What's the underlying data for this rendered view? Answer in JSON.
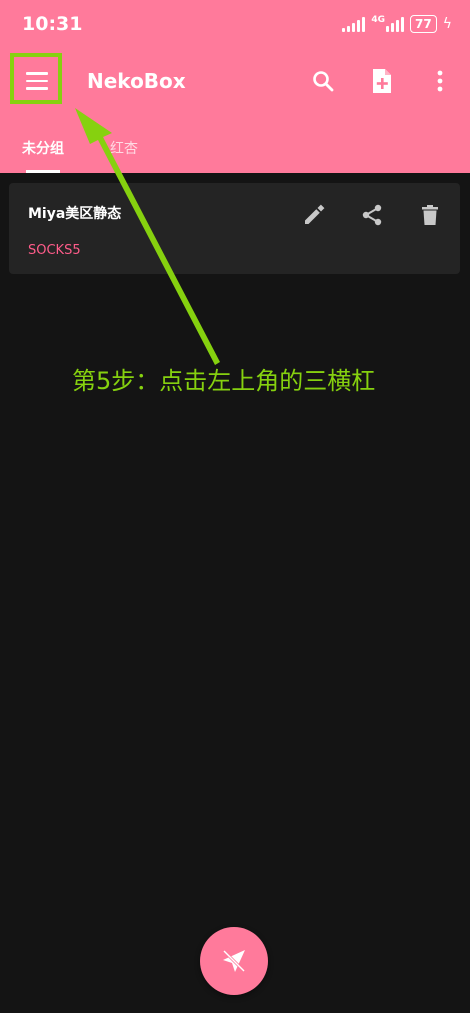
{
  "status_bar": {
    "time": "10:31",
    "network": "4G",
    "battery": "77"
  },
  "app_bar": {
    "title": "NekoBox",
    "icons": [
      "menu-icon",
      "search-icon",
      "add-file-icon",
      "more-vert-icon"
    ]
  },
  "tabs": [
    {
      "label": "未分组",
      "active": true
    },
    {
      "label": "红杏",
      "active": false
    }
  ],
  "profiles": [
    {
      "name": "Miya美区静态",
      "type": "SOCKS5"
    }
  ],
  "card_actions": [
    "edit-icon",
    "share-icon",
    "delete-icon"
  ],
  "annotation": {
    "text": "第5步：点击左上角的三横杠",
    "color": "#86d10f"
  },
  "fab": {
    "icon": "connect-plane-icon"
  },
  "colors": {
    "primary": "#ff7a9b",
    "background": "#141414",
    "card": "#242424",
    "accent_text": "#ff5c8a"
  }
}
